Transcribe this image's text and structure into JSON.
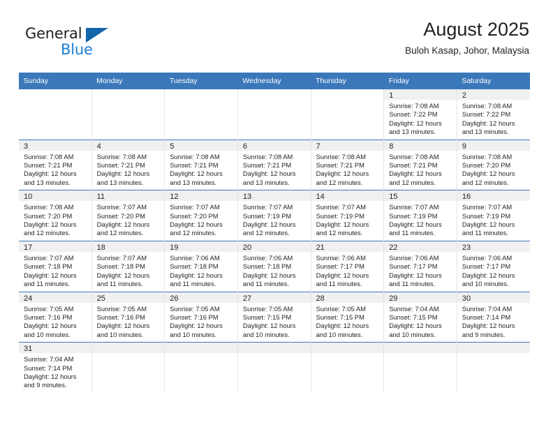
{
  "brand": {
    "line1": "General",
    "line2": "Blue",
    "triangle_icon": "triangle-icon",
    "color_dark": "#231f20",
    "color_blue": "#1b7fd4",
    "triangle_color": "#1466ab"
  },
  "header": {
    "title": "August 2025",
    "subtitle": "Buloh Kasap, Johor, Malaysia"
  },
  "theme": {
    "header_blue": "#3b78ba",
    "daynum_band": "#f0f0f0",
    "text": "#231f20"
  },
  "weekday_headers": [
    "Sunday",
    "Monday",
    "Tuesday",
    "Wednesday",
    "Thursday",
    "Friday",
    "Saturday"
  ],
  "weeks": [
    [
      {
        "day": "",
        "blank": true
      },
      {
        "day": "",
        "blank": true
      },
      {
        "day": "",
        "blank": true
      },
      {
        "day": "",
        "blank": true
      },
      {
        "day": "",
        "blank": true
      },
      {
        "day": "1",
        "sunrise": "Sunrise: 7:08 AM",
        "sunset": "Sunset: 7:22 PM",
        "daylight_1": "Daylight: 12 hours",
        "daylight_2": "and 13 minutes."
      },
      {
        "day": "2",
        "sunrise": "Sunrise: 7:08 AM",
        "sunset": "Sunset: 7:22 PM",
        "daylight_1": "Daylight: 12 hours",
        "daylight_2": "and 13 minutes."
      }
    ],
    [
      {
        "day": "3",
        "sunrise": "Sunrise: 7:08 AM",
        "sunset": "Sunset: 7:21 PM",
        "daylight_1": "Daylight: 12 hours",
        "daylight_2": "and 13 minutes."
      },
      {
        "day": "4",
        "sunrise": "Sunrise: 7:08 AM",
        "sunset": "Sunset: 7:21 PM",
        "daylight_1": "Daylight: 12 hours",
        "daylight_2": "and 13 minutes."
      },
      {
        "day": "5",
        "sunrise": "Sunrise: 7:08 AM",
        "sunset": "Sunset: 7:21 PM",
        "daylight_1": "Daylight: 12 hours",
        "daylight_2": "and 13 minutes."
      },
      {
        "day": "6",
        "sunrise": "Sunrise: 7:08 AM",
        "sunset": "Sunset: 7:21 PM",
        "daylight_1": "Daylight: 12 hours",
        "daylight_2": "and 13 minutes."
      },
      {
        "day": "7",
        "sunrise": "Sunrise: 7:08 AM",
        "sunset": "Sunset: 7:21 PM",
        "daylight_1": "Daylight: 12 hours",
        "daylight_2": "and 12 minutes."
      },
      {
        "day": "8",
        "sunrise": "Sunrise: 7:08 AM",
        "sunset": "Sunset: 7:21 PM",
        "daylight_1": "Daylight: 12 hours",
        "daylight_2": "and 12 minutes."
      },
      {
        "day": "9",
        "sunrise": "Sunrise: 7:08 AM",
        "sunset": "Sunset: 7:20 PM",
        "daylight_1": "Daylight: 12 hours",
        "daylight_2": "and 12 minutes."
      }
    ],
    [
      {
        "day": "10",
        "sunrise": "Sunrise: 7:08 AM",
        "sunset": "Sunset: 7:20 PM",
        "daylight_1": "Daylight: 12 hours",
        "daylight_2": "and 12 minutes."
      },
      {
        "day": "11",
        "sunrise": "Sunrise: 7:07 AM",
        "sunset": "Sunset: 7:20 PM",
        "daylight_1": "Daylight: 12 hours",
        "daylight_2": "and 12 minutes."
      },
      {
        "day": "12",
        "sunrise": "Sunrise: 7:07 AM",
        "sunset": "Sunset: 7:20 PM",
        "daylight_1": "Daylight: 12 hours",
        "daylight_2": "and 12 minutes."
      },
      {
        "day": "13",
        "sunrise": "Sunrise: 7:07 AM",
        "sunset": "Sunset: 7:19 PM",
        "daylight_1": "Daylight: 12 hours",
        "daylight_2": "and 12 minutes."
      },
      {
        "day": "14",
        "sunrise": "Sunrise: 7:07 AM",
        "sunset": "Sunset: 7:19 PM",
        "daylight_1": "Daylight: 12 hours",
        "daylight_2": "and 12 minutes."
      },
      {
        "day": "15",
        "sunrise": "Sunrise: 7:07 AM",
        "sunset": "Sunset: 7:19 PM",
        "daylight_1": "Daylight: 12 hours",
        "daylight_2": "and 11 minutes."
      },
      {
        "day": "16",
        "sunrise": "Sunrise: 7:07 AM",
        "sunset": "Sunset: 7:19 PM",
        "daylight_1": "Daylight: 12 hours",
        "daylight_2": "and 11 minutes."
      }
    ],
    [
      {
        "day": "17",
        "sunrise": "Sunrise: 7:07 AM",
        "sunset": "Sunset: 7:18 PM",
        "daylight_1": "Daylight: 12 hours",
        "daylight_2": "and 11 minutes."
      },
      {
        "day": "18",
        "sunrise": "Sunrise: 7:07 AM",
        "sunset": "Sunset: 7:18 PM",
        "daylight_1": "Daylight: 12 hours",
        "daylight_2": "and 11 minutes."
      },
      {
        "day": "19",
        "sunrise": "Sunrise: 7:06 AM",
        "sunset": "Sunset: 7:18 PM",
        "daylight_1": "Daylight: 12 hours",
        "daylight_2": "and 11 minutes."
      },
      {
        "day": "20",
        "sunrise": "Sunrise: 7:06 AM",
        "sunset": "Sunset: 7:18 PM",
        "daylight_1": "Daylight: 12 hours",
        "daylight_2": "and 11 minutes."
      },
      {
        "day": "21",
        "sunrise": "Sunrise: 7:06 AM",
        "sunset": "Sunset: 7:17 PM",
        "daylight_1": "Daylight: 12 hours",
        "daylight_2": "and 11 minutes."
      },
      {
        "day": "22",
        "sunrise": "Sunrise: 7:06 AM",
        "sunset": "Sunset: 7:17 PM",
        "daylight_1": "Daylight: 12 hours",
        "daylight_2": "and 11 minutes."
      },
      {
        "day": "23",
        "sunrise": "Sunrise: 7:06 AM",
        "sunset": "Sunset: 7:17 PM",
        "daylight_1": "Daylight: 12 hours",
        "daylight_2": "and 10 minutes."
      }
    ],
    [
      {
        "day": "24",
        "sunrise": "Sunrise: 7:05 AM",
        "sunset": "Sunset: 7:16 PM",
        "daylight_1": "Daylight: 12 hours",
        "daylight_2": "and 10 minutes."
      },
      {
        "day": "25",
        "sunrise": "Sunrise: 7:05 AM",
        "sunset": "Sunset: 7:16 PM",
        "daylight_1": "Daylight: 12 hours",
        "daylight_2": "and 10 minutes."
      },
      {
        "day": "26",
        "sunrise": "Sunrise: 7:05 AM",
        "sunset": "Sunset: 7:16 PM",
        "daylight_1": "Daylight: 12 hours",
        "daylight_2": "and 10 minutes."
      },
      {
        "day": "27",
        "sunrise": "Sunrise: 7:05 AM",
        "sunset": "Sunset: 7:15 PM",
        "daylight_1": "Daylight: 12 hours",
        "daylight_2": "and 10 minutes."
      },
      {
        "day": "28",
        "sunrise": "Sunrise: 7:05 AM",
        "sunset": "Sunset: 7:15 PM",
        "daylight_1": "Daylight: 12 hours",
        "daylight_2": "and 10 minutes."
      },
      {
        "day": "29",
        "sunrise": "Sunrise: 7:04 AM",
        "sunset": "Sunset: 7:15 PM",
        "daylight_1": "Daylight: 12 hours",
        "daylight_2": "and 10 minutes."
      },
      {
        "day": "30",
        "sunrise": "Sunrise: 7:04 AM",
        "sunset": "Sunset: 7:14 PM",
        "daylight_1": "Daylight: 12 hours",
        "daylight_2": "and 9 minutes."
      }
    ],
    [
      {
        "day": "31",
        "sunrise": "Sunrise: 7:04 AM",
        "sunset": "Sunset: 7:14 PM",
        "daylight_1": "Daylight: 12 hours",
        "daylight_2": "and 9 minutes."
      },
      {
        "day": "",
        "empty": true
      },
      {
        "day": "",
        "empty": true
      },
      {
        "day": "",
        "empty": true
      },
      {
        "day": "",
        "empty": true
      },
      {
        "day": "",
        "empty": true
      },
      {
        "day": "",
        "empty": true
      }
    ]
  ]
}
